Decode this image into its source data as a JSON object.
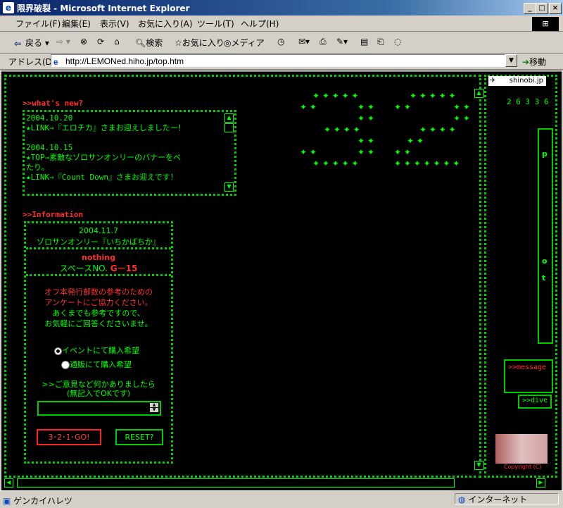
{
  "window": {
    "title": "限界破裂 - Microsoft Internet Explorer",
    "minimize": "_",
    "maximize": "□",
    "close": "×"
  },
  "menu": [
    "ファイル(F)",
    "編集(E)",
    "表示(V)",
    "お気に入り(A)",
    "ツール(T)",
    "ヘルプ(H)"
  ],
  "toolbar": {
    "back": "戻る",
    "search": "検索",
    "favorites": "お気に入り",
    "media": "メディア"
  },
  "address": {
    "label": "アドレス(D)",
    "url": "http://LEMONed.hiho.jp/top.htm",
    "go": "移動"
  },
  "whatsnew": {
    "heading": ">>what's new?",
    "lines": [
      "2004.10.20",
      "★LINK⇒『エロチカ』さまお迎えしましたー！",
      "",
      "2004.10.15",
      "★TOP⇒素敵なゾロサンオンリーのバナーをべ",
      "たり。",
      "★LINK⇒『Count Down』さまお迎えです！"
    ]
  },
  "information": {
    "heading": ">>Information",
    "event_date": "2004.11.7",
    "event_name": "ゾロサンオンリー『いちかばちか』",
    "status": "nothing",
    "space_label": "スペースNO.",
    "space_no": "G－15",
    "survey_lines": [
      "オフ本発行部数の参考のための",
      "アンケートにご協力ください。",
      "あくまでも参考ですので、",
      "お気軽にご回答くださいませ。"
    ],
    "radio1": "イベントにて購入希望",
    "radio2": "通販にて購入希望",
    "comment_lines": [
      ">>ご意見など何かありましたら",
      "(無記入でOKです)"
    ],
    "go_button": "3･2･1･GO!",
    "reset_button": "RESET?"
  },
  "right": {
    "badge": "shinobi.jp",
    "counter": "2 6 3 3 6",
    "message_link": ">>message",
    "dive_link": ">>dive",
    "copyright": "Copyright (C)",
    "menu_letters": [
      "p",
      "o",
      "t"
    ]
  },
  "statusbar": {
    "text": "ゲンカイハレツ",
    "zone": "インターネット"
  },
  "colors": {
    "bg": "#000000",
    "green": "#00ff00",
    "red": "#ff3030"
  }
}
